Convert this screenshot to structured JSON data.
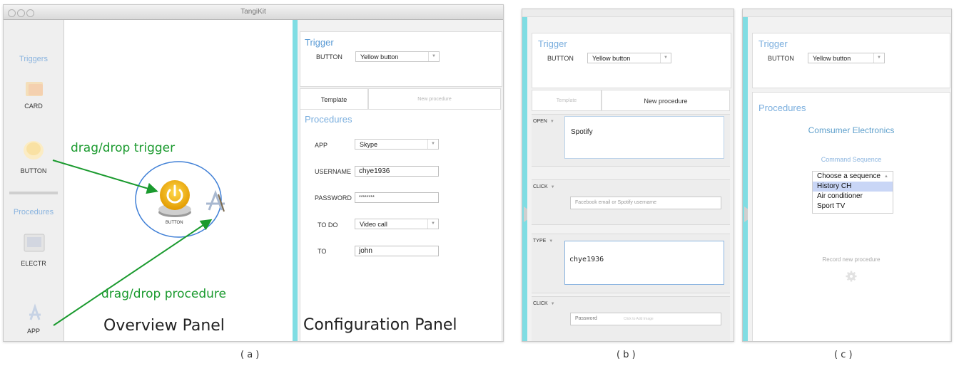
{
  "window_title": "TangiKit",
  "sidebar": {
    "triggers_heading": "Triggers",
    "procedures_heading": "Procedures",
    "items": [
      {
        "label": "CARD"
      },
      {
        "label": "BUTTON"
      },
      {
        "label": "ELECTR"
      },
      {
        "label": "APP"
      }
    ]
  },
  "overview": {
    "button_label": "BUTTON",
    "drag_trigger": "drag/drop trigger",
    "drag_procedure": "drag/drop procedure",
    "caption": "Overview Panel"
  },
  "config_a": {
    "trigger_heading": "Trigger",
    "trigger_type": "BUTTON",
    "trigger_value": "Yellow button",
    "tab_template": "Template",
    "tab_new": "New procedure",
    "procedures_heading": "Procedures",
    "rows": [
      {
        "label": "APP",
        "value": "Skype"
      },
      {
        "label": "USERNAME",
        "value": "chye1936"
      },
      {
        "label": "PASSWORD",
        "value": "********"
      },
      {
        "label": "TO DO",
        "value": "Video call"
      },
      {
        "label": "TO",
        "value": "john"
      }
    ],
    "caption": "Configuration Panel"
  },
  "config_b": {
    "trigger_heading": "Trigger",
    "trigger_type": "BUTTON",
    "trigger_value": "Yellow button",
    "tab_template": "Template",
    "tab_new": "New procedure",
    "steps": [
      {
        "tag": "OPEN",
        "value": "Spotify"
      },
      {
        "tag": "CLICK",
        "placeholder": "Facebook email or Spotify username"
      },
      {
        "tag": "TYPE",
        "value": "chye1936"
      },
      {
        "tag": "CLICK",
        "placeholder": "Password",
        "hint": "Click to Add Image"
      }
    ]
  },
  "config_c": {
    "trigger_heading": "Trigger",
    "trigger_type": "BUTTON",
    "trigger_value": "Yellow button",
    "procedures_heading": "Procedures",
    "category": "Comsumer Electronics",
    "command_label": "Command Sequence",
    "options": [
      "Choose a sequence",
      "History CH",
      "Air conditioner",
      "Sport TV"
    ],
    "selected": "History CH",
    "record": "Record new procedure"
  },
  "captions": {
    "a": "( a )",
    "b": "( b )",
    "c": "( c )"
  },
  "colors": {
    "accent_blue": "#5b9bd5",
    "annotation_green": "#1a9a2e",
    "cyan_bar": "#7fdde3",
    "button_yellow": "#f3b800"
  }
}
